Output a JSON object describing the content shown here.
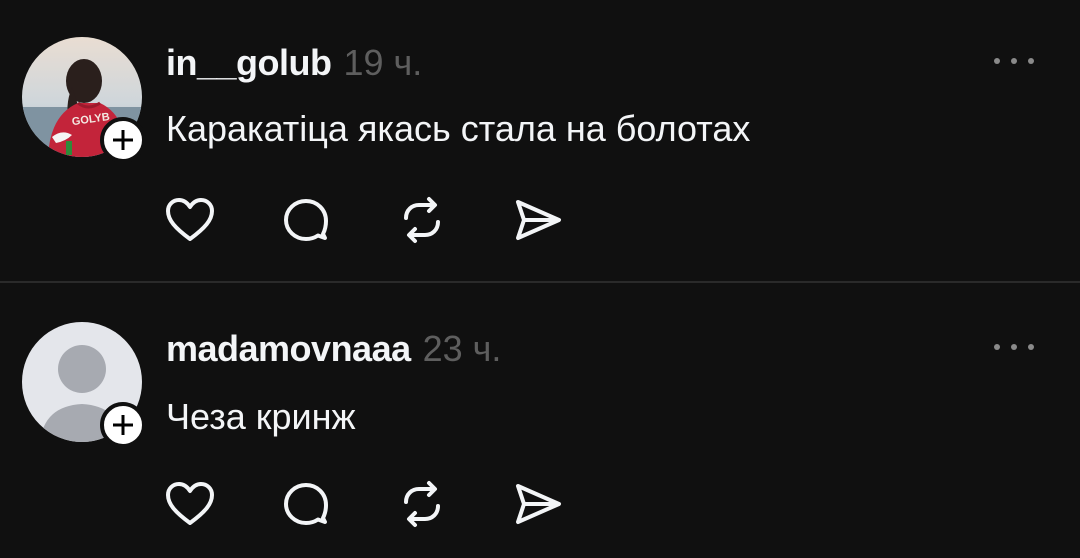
{
  "posts": [
    {
      "username": "in__golub",
      "time": "19 ч.",
      "text": "Каракатіца якась стала на болотах",
      "avatar_type": "photo",
      "avatar_shirt_text": "GOLYB"
    },
    {
      "username": "madamovnaaa",
      "time": "23 ч.",
      "text": "Чеза кринж",
      "avatar_type": "default-silhouette"
    }
  ],
  "icons": {
    "follow": "plus-icon",
    "more": "more-horizontal-icon",
    "like": "heart-icon",
    "reply": "comment-bubble-icon",
    "repost": "repost-icon",
    "share": "send-icon"
  },
  "colors": {
    "background": "#101010",
    "text_primary": "#f3f5f7",
    "text_secondary": "#5e5e5e",
    "divider": "#2a2a2a",
    "icon": "#f3f5f7"
  }
}
